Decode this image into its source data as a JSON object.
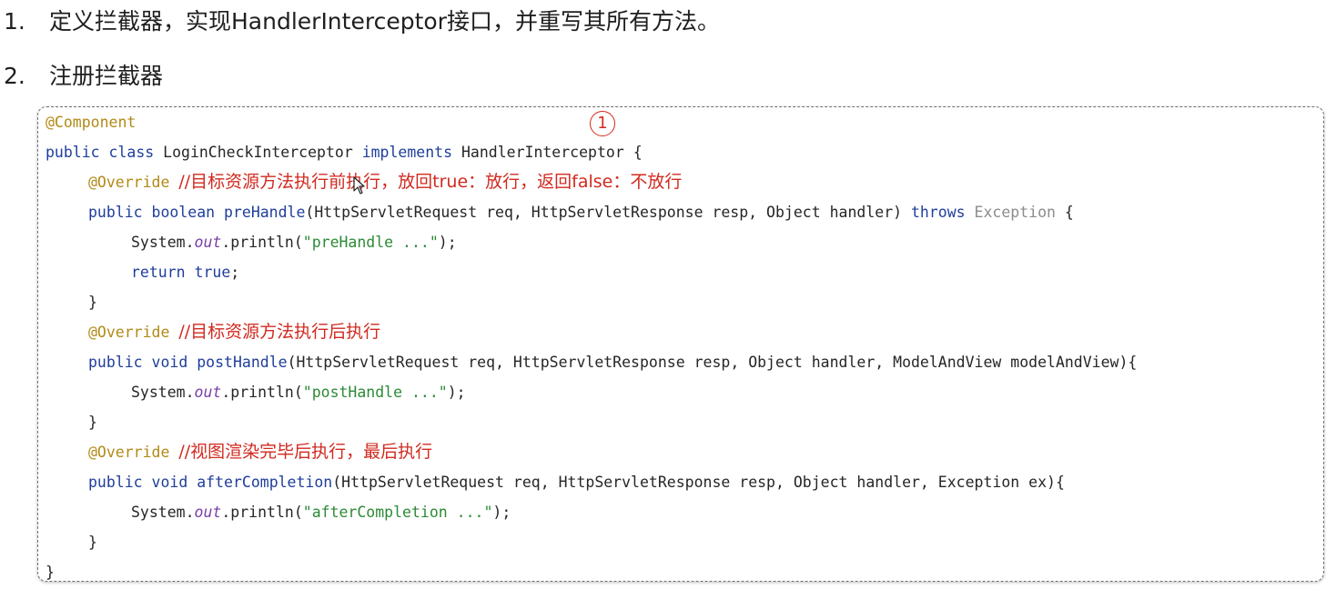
{
  "steps": [
    {
      "num": "1.",
      "text": "定义拦截器，实现HandlerInterceptor接口，并重写其所有方法。"
    },
    {
      "num": "2.",
      "text": "注册拦截器"
    }
  ],
  "marker": "1",
  "code": {
    "annotation_component": "@Component",
    "class_kw": "public class ",
    "class_name": "LoginCheckInterceptor ",
    "implements_kw": "implements ",
    "interface_name": "HandlerInterceptor {",
    "override": "@Override",
    "comment_pre": "//目标资源方法执行前执行，放回true：放行，返回false：不放行",
    "pre_sig_kw": "public boolean ",
    "pre_name": "preHandle",
    "pre_params": "(HttpServletRequest req, HttpServletResponse resp, Object handler) ",
    "throws_kw": "throws ",
    "exception": "Exception",
    "brace_open": " {",
    "system": "System.",
    "out": "out",
    "println_open": ".println(",
    "pre_str": "\"preHandle ...\"",
    "println_close": ");",
    "return_kw": "return true",
    "semicolon": ";",
    "brace_close": "}",
    "comment_post": "//目标资源方法执行后执行",
    "void_kw": "public void ",
    "post_name": "postHandle",
    "post_params": "(HttpServletRequest req, HttpServletResponse resp, Object handler, ModelAndView modelAndView){",
    "post_str": "\"postHandle ...\"",
    "comment_after": "//视图渲染完毕后执行，最后执行",
    "after_name": "afterCompletion",
    "after_params": "(HttpServletRequest req, HttpServletResponse resp, Object handler, Exception ex){",
    "after_str": "\"afterCompletion ...\"",
    "class_close": "}"
  },
  "colors": {
    "keyword": "#1f3e9c",
    "annotation": "#b28a17",
    "string": "#2c8a35",
    "comment": "#d12a1f",
    "static_field": "#7a3ea8"
  }
}
